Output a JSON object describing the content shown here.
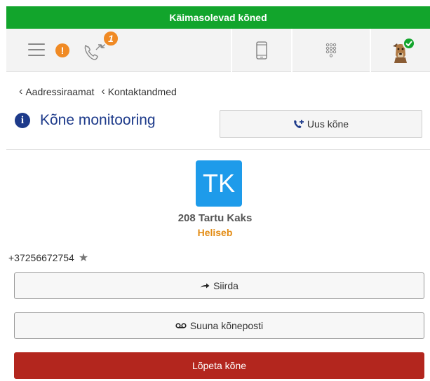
{
  "banner": {
    "text": "Käimasolevad kõned"
  },
  "toolbar": {
    "warning_symbol": "!",
    "calls_badge_count": "1",
    "icons": [
      "menu-icon",
      "warning-icon",
      "active-calls-icon",
      "mobile-phone-icon",
      "dialpad-icon",
      "user-avatar",
      "online-status-check-icon"
    ]
  },
  "breadcrumb": {
    "items": [
      "Aadressiraamat",
      "Kontaktandmed"
    ]
  },
  "page": {
    "title": "Kõne monitooring",
    "new_call_label": "Uus kõne"
  },
  "contact": {
    "initials": "TK",
    "name": "208 Tartu Kaks",
    "status": "Heliseb",
    "phone": "+37256672754"
  },
  "actions": {
    "transfer_label": "Siirda",
    "voicemail_label": "Suuna kõneposti",
    "hangup_label": "Lõpeta kõne"
  },
  "colors": {
    "banner": "#12a52c",
    "accent_blue": "#1d3a8a",
    "avatar_blue": "#1e9bea",
    "status_orange": "#e38c14",
    "badge_orange": "#f08a24",
    "hangup_red": "#b3261e"
  }
}
